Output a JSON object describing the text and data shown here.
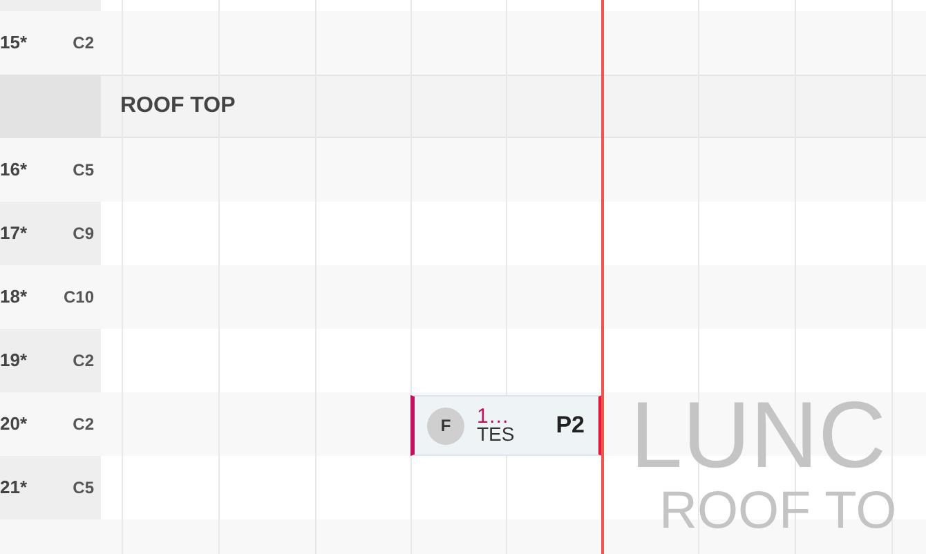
{
  "rows": [
    {
      "kind": "table",
      "table": "15*",
      "capacity": "C2",
      "reservations": []
    },
    {
      "kind": "section",
      "label": "ROOF TOP"
    },
    {
      "kind": "table",
      "table": "16*",
      "capacity": "C5",
      "reservations": []
    },
    {
      "kind": "table",
      "table": "17*",
      "capacity": "C9",
      "reservations": []
    },
    {
      "kind": "table",
      "table": "18*",
      "capacity": "C10",
      "reservations": []
    },
    {
      "kind": "table",
      "table": "19*",
      "capacity": "C2",
      "reservations": []
    },
    {
      "kind": "table",
      "table": "20*",
      "capacity": "C2",
      "reservations": [
        {
          "badge": "F",
          "number": "1…",
          "name": "TES",
          "table_label": "P2"
        }
      ]
    },
    {
      "kind": "table",
      "table": "21*",
      "capacity": "C5",
      "reservations": []
    }
  ],
  "background_label": {
    "title": "LUNC",
    "subtitle": "ROOF TO"
  }
}
